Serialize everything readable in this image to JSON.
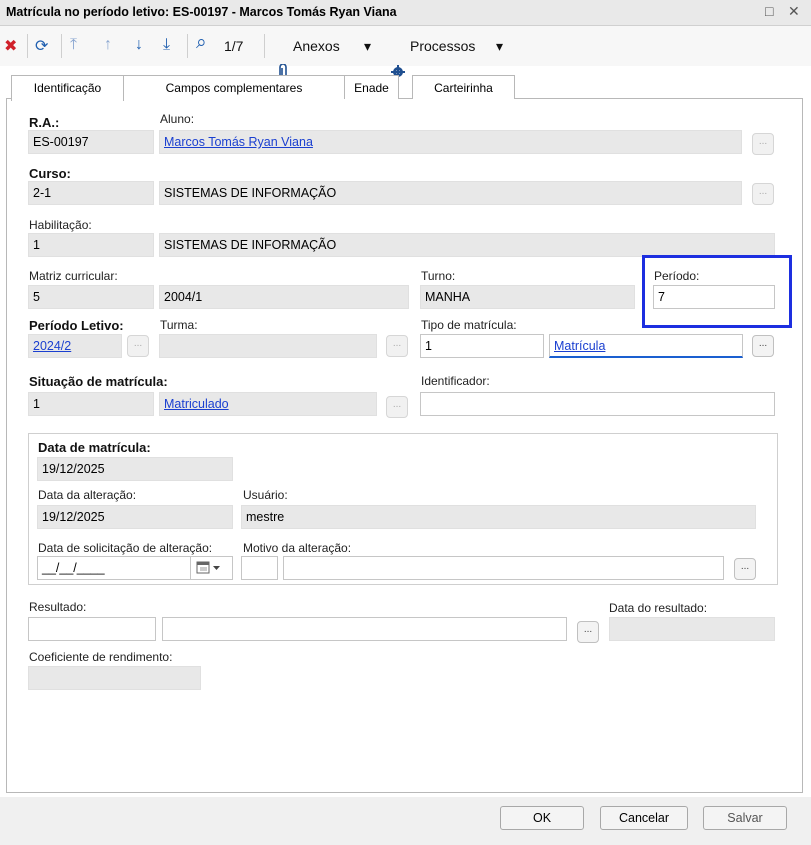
{
  "window": {
    "title": "Matrícula no período letivo: ES-00197 - Marcos Tomás Ryan Viana",
    "restore_glyph": "□",
    "close_glyph": "✕"
  },
  "toolbar": {
    "delete_icon": "✖",
    "refresh_icon": "⟳",
    "first_icon": "⤒",
    "up_icon": "↑",
    "down_icon": "↓",
    "last_icon": "⤓",
    "search_icon": "⌕",
    "record_position": "1/7",
    "attachments_label": "Anexos",
    "processes_label": "Processos",
    "caret": "▾"
  },
  "tabs": [
    {
      "label": "Identificação",
      "active": true
    },
    {
      "label": "Campos complementares",
      "active": false
    },
    {
      "label": "Enade",
      "active": false
    },
    {
      "label": "Carteirinha",
      "active": false
    }
  ],
  "form": {
    "ra_label": "R.A.:",
    "ra_value": "ES-00197",
    "aluno_label": "Aluno:",
    "aluno_value": "Marcos Tomás Ryan Viana",
    "curso_label": "Curso:",
    "curso_code": "2-1",
    "curso_name": "SISTEMAS DE INFORMAÇÃO",
    "habilitacao_label": "Habilitação:",
    "habilitacao_code": "1",
    "habilitacao_name": "SISTEMAS DE INFORMAÇÃO",
    "matriz_label": "Matriz curricular:",
    "matriz_code": "5",
    "matriz_value": "2004/1",
    "turno_label": "Turno:",
    "turno_value": "MANHA",
    "periodo_label": "Período:",
    "periodo_value": "7",
    "periodo_letivo_label": "Período Letivo:",
    "periodo_letivo_value": "2024/2",
    "turma_label": "Turma:",
    "turma_value": "",
    "tipo_matricula_label": "Tipo de matrícula:",
    "tipo_matricula_code": "1",
    "tipo_matricula_value": "Matrícula",
    "situacao_label": "Situação de matrícula:",
    "situacao_code": "1",
    "situacao_value": "Matriculado",
    "identificador_label": "Identificador:",
    "identificador_value": "",
    "data_matricula_label": "Data de matrícula:",
    "data_matricula_value": "19/12/2025",
    "data_alteracao_label": "Data da alteração:",
    "data_alteracao_value": "19/12/2025",
    "usuario_label": "Usuário:",
    "usuario_value": "mestre",
    "data_solicitacao_label": "Data de solicitação de alteração:",
    "data_solicitacao_value": "__/__/____",
    "motivo_label": "Motivo da alteração:",
    "motivo_code": "",
    "motivo_value": "",
    "resultado_label": "Resultado:",
    "resultado_code": "",
    "resultado_value": "",
    "data_resultado_label": "Data do resultado:",
    "data_resultado_value": "",
    "coeficiente_label": "Coeficiente de rendimento:",
    "coeficiente_value": "",
    "lookup_label": "..."
  },
  "footer": {
    "ok_label": "OK",
    "cancel_label": "Cancelar",
    "save_label": "Salvar"
  },
  "colors": {
    "highlight": "#1d2fe0",
    "link": "#1a3fd0",
    "delete": "#d0202a"
  }
}
